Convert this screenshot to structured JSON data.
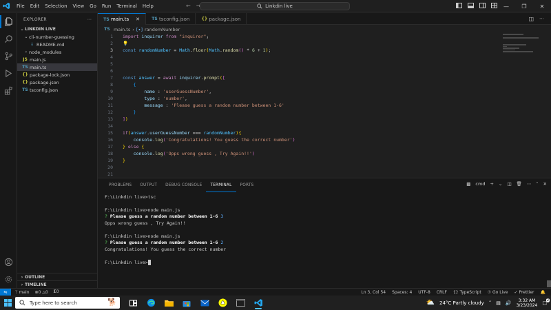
{
  "window": {
    "search_text": "Linkdin live",
    "menu": [
      "File",
      "Edit",
      "Selection",
      "View",
      "Go",
      "Run",
      "Terminal",
      "Help"
    ]
  },
  "sidebar": {
    "header": "EXPLORER",
    "root": "LINKDIN LIVE",
    "items": [
      {
        "label": "cli-number-guessing",
        "type": "folder-open",
        "depth": 1
      },
      {
        "label": "README.md",
        "type": "md",
        "depth": 2
      },
      {
        "label": "node_modules",
        "type": "folder",
        "depth": 1
      },
      {
        "label": "main.js",
        "type": "js",
        "depth": 1
      },
      {
        "label": "main.ts",
        "type": "ts",
        "depth": 1,
        "selected": true
      },
      {
        "label": "package-lock.json",
        "type": "json",
        "depth": 1
      },
      {
        "label": "package.json",
        "type": "json",
        "depth": 1
      },
      {
        "label": "tsconfig.json",
        "type": "tsconfig",
        "depth": 1
      }
    ],
    "outline": "OUTLINE",
    "timeline": "TIMELINE"
  },
  "tabs": [
    {
      "label": "main.ts",
      "icon": "TS",
      "active": true
    },
    {
      "label": "tsconfig.json",
      "icon": "TS",
      "active": false
    },
    {
      "label": "package.json",
      "icon": "{}",
      "active": false
    }
  ],
  "breadcrumb": {
    "file": "main.ts",
    "symbol": "randomNumber"
  },
  "editor": {
    "line_numbers": [
      "1",
      "2",
      "3",
      "4",
      "5",
      "6",
      "7",
      "8",
      "9",
      "10",
      "11",
      "12",
      "13",
      "14",
      "15",
      "16",
      "17",
      "18",
      "19",
      "20",
      "21"
    ],
    "current_line": 3
  },
  "panel": {
    "tabs": [
      "PROBLEMS",
      "OUTPUT",
      "DEBUG CONSOLE",
      "TERMINAL",
      "PORTS"
    ],
    "active_tab": "TERMINAL",
    "shell": "cmd",
    "terminal": {
      "l1": "F:\\Linkdin live>tsc",
      "l2": "F:\\Linkdin live>node main.js",
      "q_mark": "?",
      "question": "Please guess a random number between 1-6",
      "answer1": "3",
      "result1": "Opps wrong guess , Try Again!!",
      "l5": "F:\\Linkdin live>node main.js",
      "answer2": "2",
      "result2": "Congratulations! You guess the correct number",
      "prompt": "F:\\Linkdin live>"
    }
  },
  "statusbar": {
    "branch": "main",
    "errors": "0",
    "warnings": "0",
    "ports": "0",
    "position": "Ln 3, Col 54",
    "spaces": "Spaces: 4",
    "encoding": "UTF-8",
    "eol": "CRLF",
    "language": "TypeScript",
    "golive": "Go Live",
    "prettier": "Prettier"
  },
  "taskbar": {
    "search_placeholder": "Type here to search",
    "weather": "24°C  Partly cloudy",
    "time": "3:32 AM",
    "date": "3/23/2024",
    "notifications": "2"
  }
}
